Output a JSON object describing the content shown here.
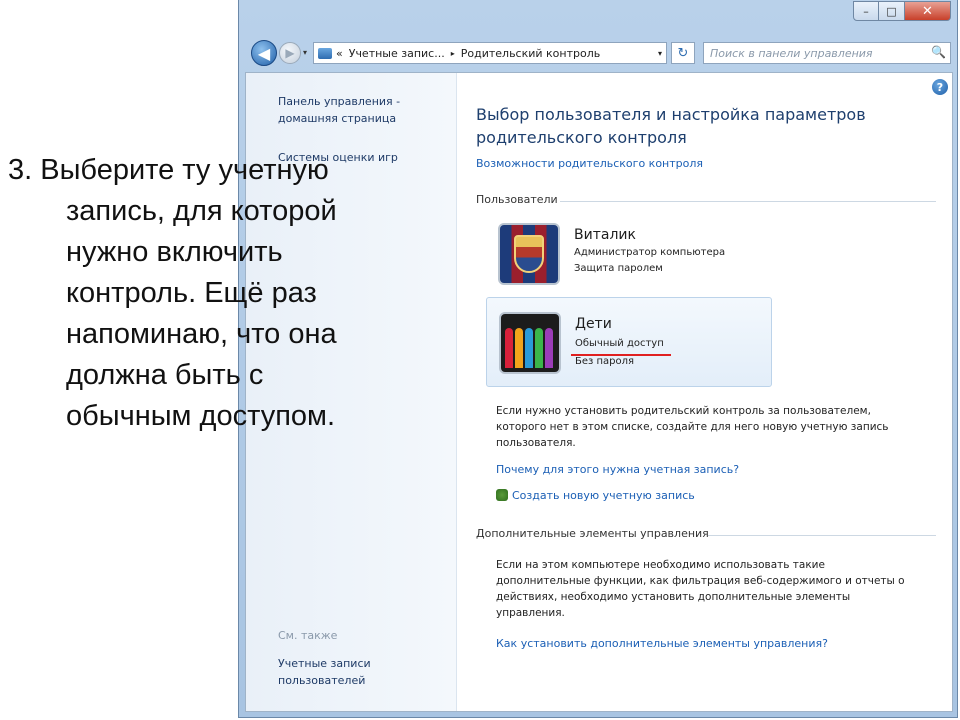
{
  "window": {
    "controls": {
      "minimize": "–",
      "maximize": "□",
      "close": "✕"
    }
  },
  "navbar": {
    "back_icon": "◀",
    "forward_icon": "▶",
    "dropdown_icon": "▾",
    "crumb_prefix": "«",
    "crumbs": [
      "Учетные запис...",
      "Родительский контроль"
    ],
    "crumb_separator": "▸",
    "refresh_icon": "↻",
    "search_placeholder": "Поиск в панели управления",
    "search_icon": "🔍"
  },
  "sidebar": {
    "home_link": "Панель управления - домашняя страница",
    "games_link": "Системы оценки игр",
    "see_also_header": "См. также",
    "accounts_link": "Учетные записи пользователей"
  },
  "main": {
    "help_icon": "?",
    "title": "Выбор пользователя и настройка параметров родительского контроля",
    "features_link": "Возможности родительского контроля",
    "users_header": "Пользователи",
    "users": [
      {
        "name": "Виталик",
        "line1": "Администратор компьютера",
        "line2": "Защита паролем"
      },
      {
        "name": "Дети",
        "line1": "Обычный доступ",
        "line2": "Без пароля"
      }
    ],
    "info_text": "Если нужно установить родительский контроль за пользователем, которого нет в этом списке, создайте для него новую учетную запись пользователя.",
    "why_link": "Почему для этого нужна учетная запись?",
    "create_link": "Создать новую учетную запись",
    "extra_header": "Дополнительные элементы управления",
    "extra_text": "Если на этом компьютере необходимо использовать такие дополнительные функции, как фильтрация веб-содержимого и отчеты о действиях, необходимо установить дополнительные элементы управления.",
    "extra_link": "Как установить дополнительные элементы управления?"
  },
  "overlay": {
    "lines": [
      "3. Выберите ту учетную",
      "запись, для которой",
      "нужно включить",
      "контроль. Ещё раз",
      "напоминаю, что она",
      "должна быть с",
      "обычным доступом."
    ]
  },
  "colors": {
    "link": "#1b5fb5",
    "title": "#1e3f6e",
    "highlight_underline": "#e02020",
    "close_button": "#c8402a"
  }
}
